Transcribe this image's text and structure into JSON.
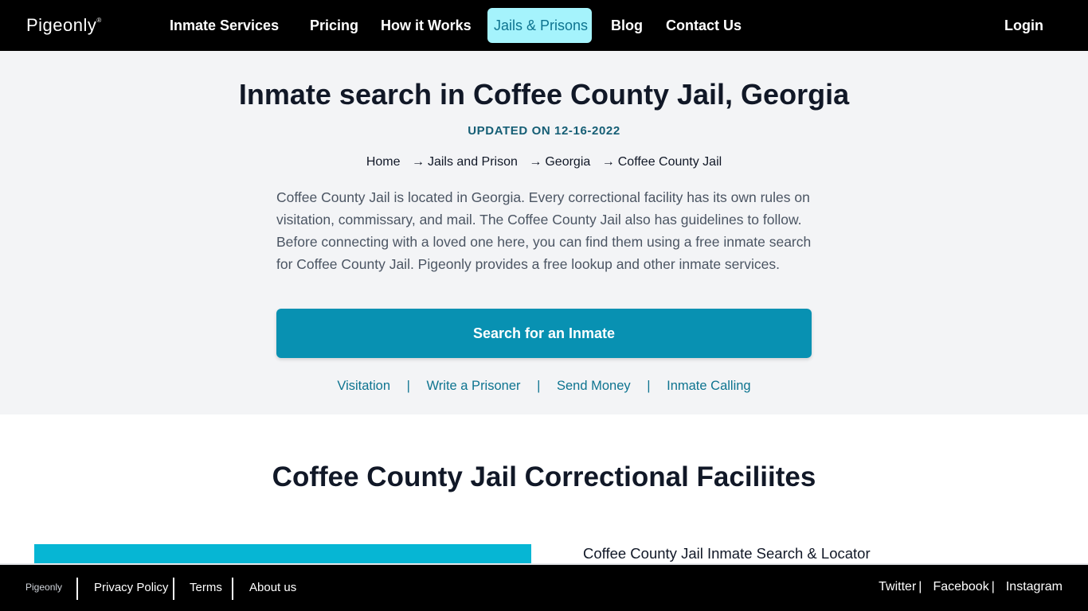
{
  "nav": {
    "logo": "Pigeonly",
    "logo_mark": "®",
    "items": [
      {
        "label": "Inmate Services",
        "active": false
      },
      {
        "label": "Pricing",
        "active": false
      },
      {
        "label": "How it Works",
        "active": false
      },
      {
        "label": "Jails & Prisons",
        "active": true
      },
      {
        "label": "Blog",
        "active": false
      },
      {
        "label": "Contact Us",
        "active": false
      }
    ],
    "login": "Login"
  },
  "hero": {
    "title": "Inmate search in Coffee County Jail, Georgia",
    "updated": "UPDATED ON 12-16-2022",
    "breadcrumb": [
      {
        "label": "Home"
      },
      {
        "label": "Jails and Prison"
      },
      {
        "label": "Georgia"
      },
      {
        "label": "Coffee County Jail"
      }
    ],
    "breadcrumb_arrow": "→",
    "description": "Coffee County Jail is located in Georgia. Every correctional facility has its own rules on visitation, commissary, and mail. The Coffee County Jail also has guidelines to follow. Before connecting with a loved one here, you can find them using a free inmate search for Coffee County Jail. Pigeonly provides a free lookup and other inmate services.",
    "search_button": "Search for an Inmate",
    "quick_links": [
      "Visitation",
      "Write a Prisoner",
      "Send Money",
      "Inmate Calling"
    ],
    "quick_links_separator": "|"
  },
  "facilities": {
    "title": "Coffee County Jail Correctional Faciliites",
    "item_link": "Coffee County Jail Inmate Search & Locator"
  },
  "footer": {
    "logo": "Pigeonly",
    "links": [
      "Privacy Policy",
      "Terms",
      "About us"
    ],
    "social": [
      "Twitter",
      "Facebook",
      "Instagram"
    ],
    "social_separator": "|"
  },
  "colors": {
    "nav_bg": "#000000",
    "active_tab_bg": "#a5f3fc",
    "active_tab_text": "#0e7490",
    "primary_button": "#0891b2",
    "accent_bar": "#06b6d4",
    "link": "#0e7490",
    "hero_bg": "#f3f4f6"
  }
}
